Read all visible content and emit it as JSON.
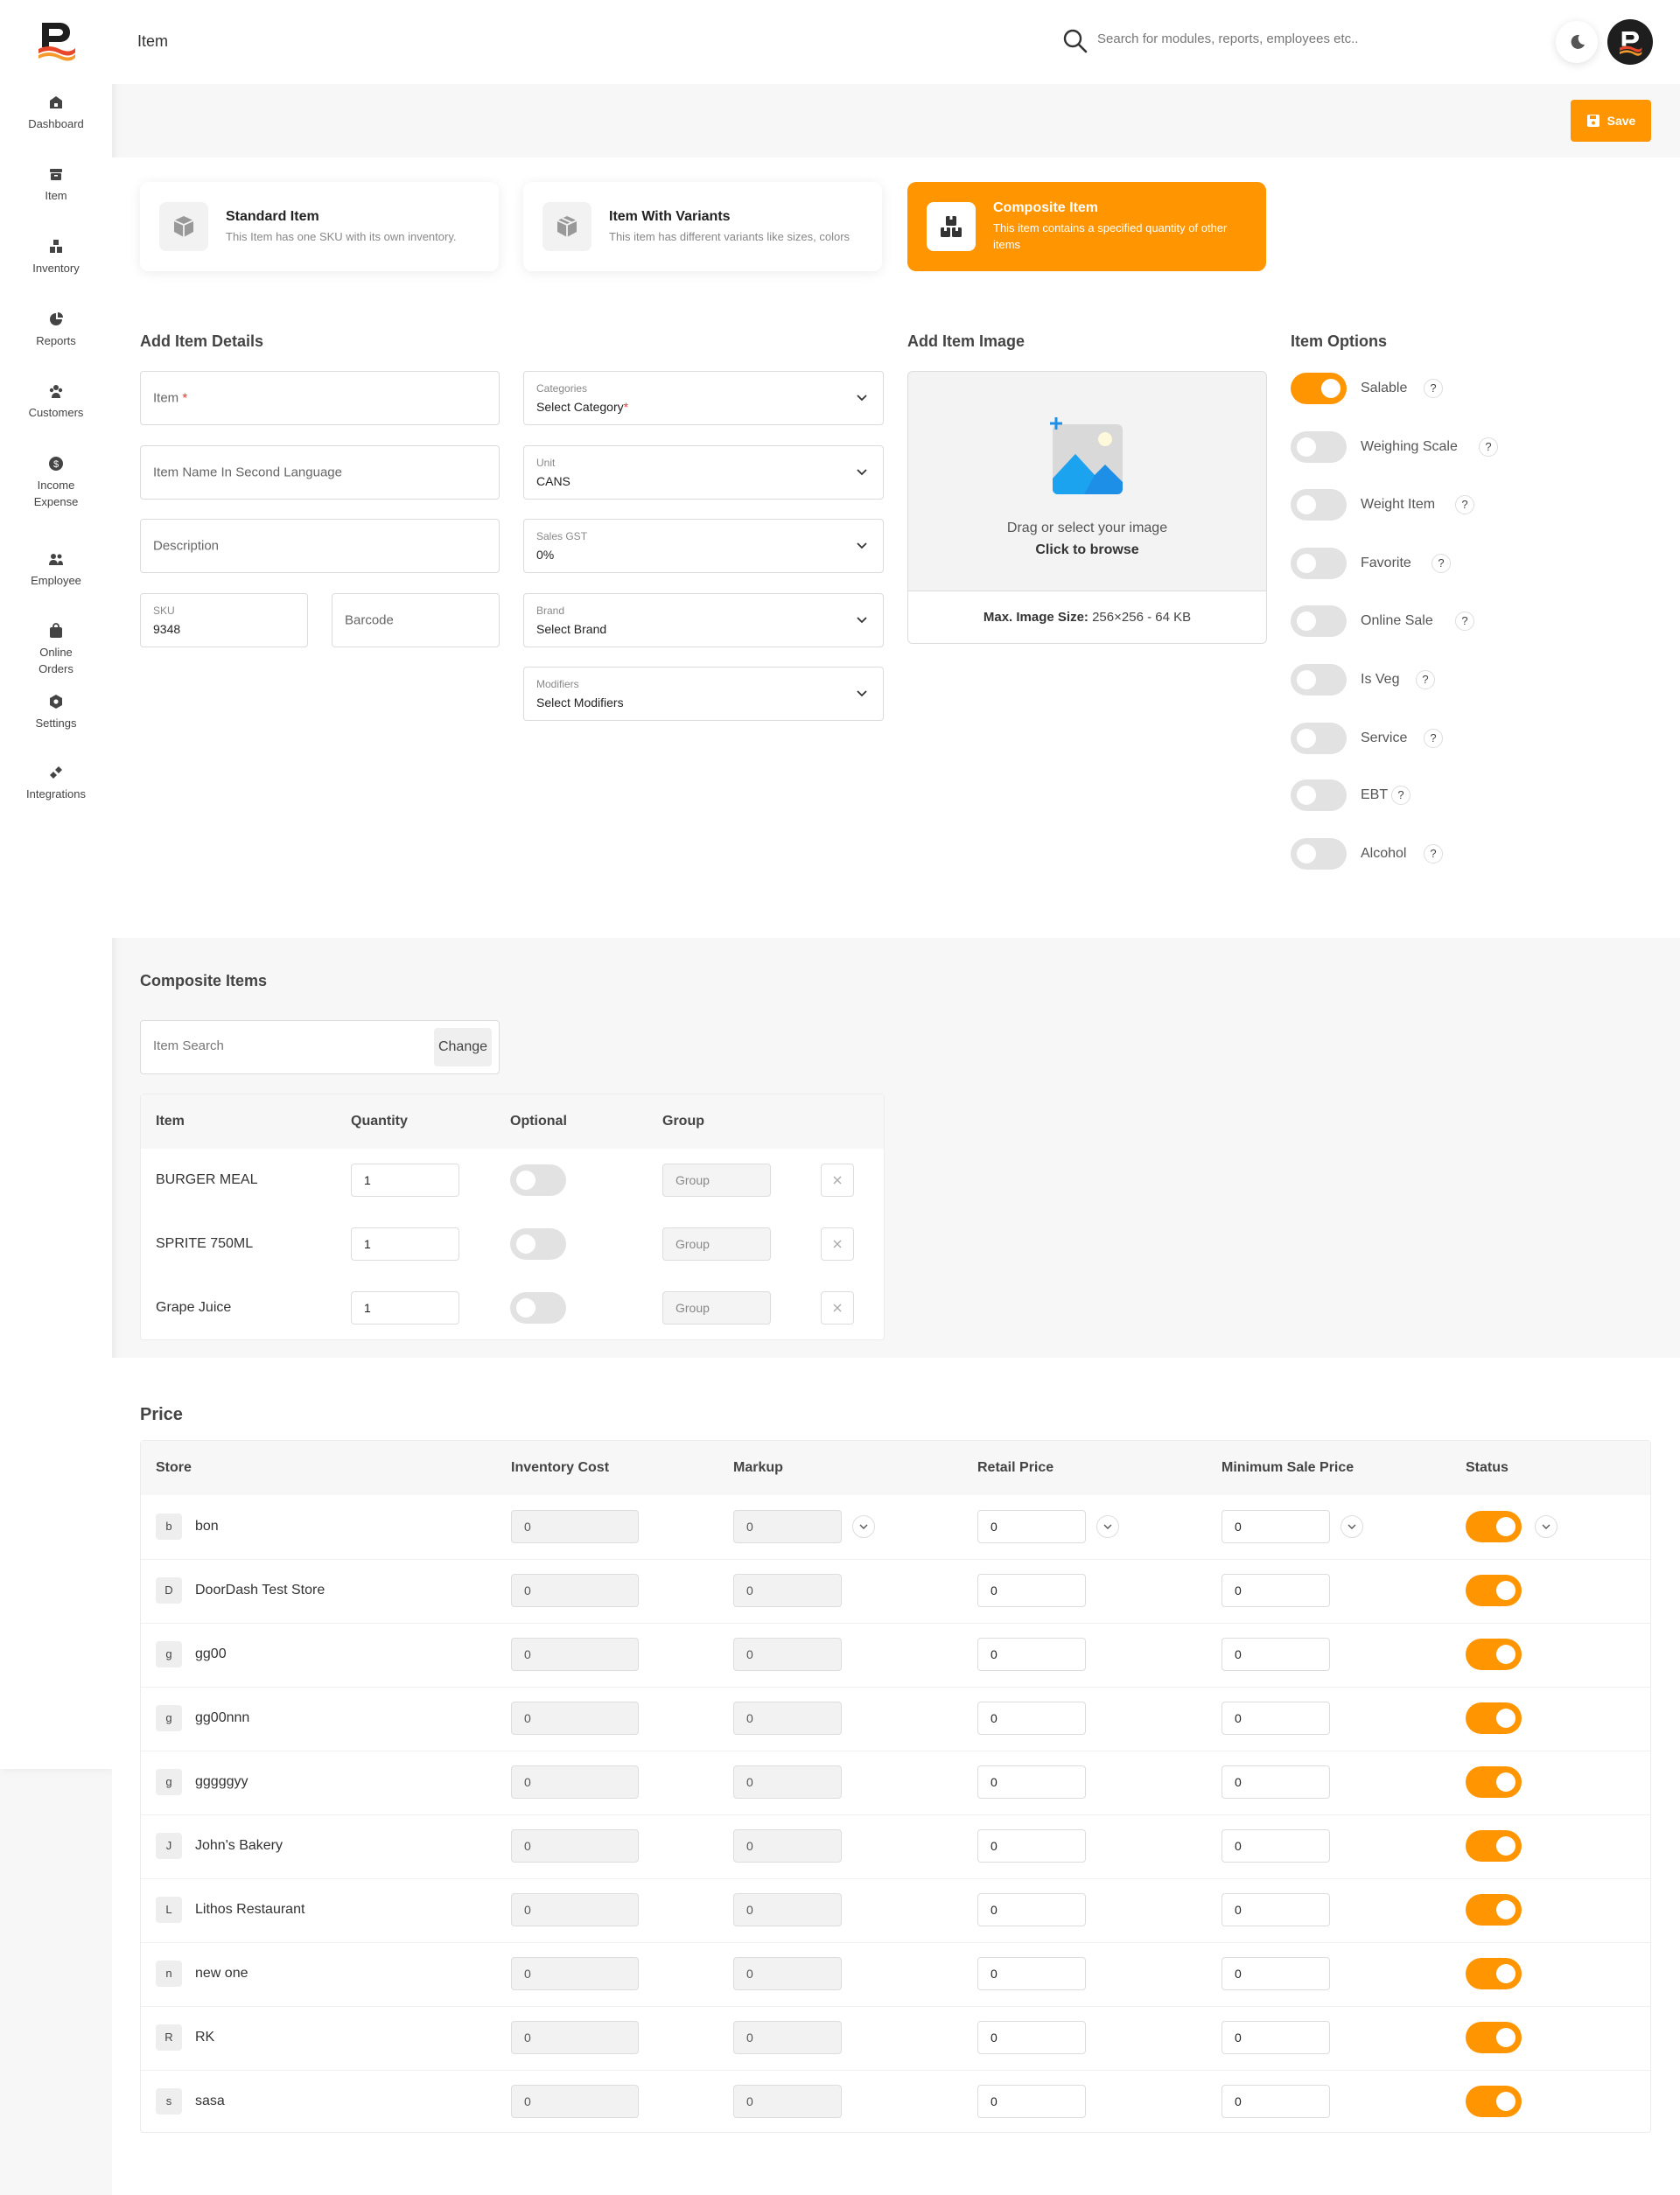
{
  "header": {
    "title": "Item",
    "search_placeholder": "Search for modules, reports, employees etc.."
  },
  "sidebar": {
    "items": [
      {
        "label": "Dashboard",
        "icon": "home-icon"
      },
      {
        "label": "Item",
        "icon": "archive-icon"
      },
      {
        "label": "Inventory",
        "icon": "boxes-icon"
      },
      {
        "label": "Reports",
        "icon": "pie-chart-icon"
      },
      {
        "label": "Customers",
        "icon": "users-icon"
      },
      {
        "label": "Income Expense",
        "icon": "dollar-icon"
      },
      {
        "label": "Employee",
        "icon": "employee-icon"
      },
      {
        "label": "Online Orders",
        "icon": "shopping-bag-icon"
      },
      {
        "label": "Settings",
        "icon": "gear-icon"
      },
      {
        "label": "Integrations",
        "icon": "plug-icon"
      }
    ]
  },
  "toolbar": {
    "save_label": "Save"
  },
  "item_types": [
    {
      "title": "Standard Item",
      "desc": "This Item has one SKU with its own inventory.",
      "active": false
    },
    {
      "title": "Item With Variants",
      "desc": "This item has different variants like sizes, colors",
      "active": false
    },
    {
      "title": "Composite Item",
      "desc": "This item contains a specified quantity of other items",
      "active": true
    }
  ],
  "details": {
    "title": "Add Item Details",
    "item_placeholder": "Item",
    "item_required": "*",
    "second_language_placeholder": "Item Name In Second Language",
    "description_placeholder": "Description",
    "sku_label": "SKU",
    "sku_value": "9348",
    "barcode_placeholder": "Barcode",
    "categories_label": "Categories",
    "categories_value": "Select Category",
    "categories_required": "*",
    "unit_label": "Unit",
    "unit_value": "CANS",
    "gst_label": "Sales GST",
    "gst_value": "0%",
    "brand_label": "Brand",
    "brand_value": "Select Brand",
    "modifiers_label": "Modifiers",
    "modifiers_value": "Select Modifiers"
  },
  "image": {
    "title": "Add Item Image",
    "drag_text": "Drag or select your image",
    "browse_text": "Click to browse",
    "max_label": "Max. Image Size:",
    "max_value": "256×256 - 64 KB"
  },
  "options": {
    "title": "Item Options",
    "items": [
      {
        "label": "Salable",
        "on": true
      },
      {
        "label": "Weighing Scale",
        "on": false
      },
      {
        "label": "Weight Item",
        "on": false
      },
      {
        "label": "Favorite",
        "on": false
      },
      {
        "label": "Online Sale",
        "on": false
      },
      {
        "label": "Is Veg",
        "on": false
      },
      {
        "label": "Service",
        "on": false
      },
      {
        "label": "EBT",
        "on": false
      },
      {
        "label": "Alcohol",
        "on": false
      }
    ],
    "help": "?"
  },
  "composite": {
    "title": "Composite Items",
    "search_placeholder": "Item Search",
    "change_label": "Change",
    "headers": [
      "Item",
      "Quantity",
      "Optional",
      "Group"
    ],
    "rows": [
      {
        "item": "BURGER MEAL",
        "quantity": "1",
        "optional": false,
        "group": "Group"
      },
      {
        "item": "SPRITE 750ML",
        "quantity": "1",
        "optional": false,
        "group": "Group"
      },
      {
        "item": "Grape Juice",
        "quantity": "1",
        "optional": false,
        "group": "Group"
      }
    ]
  },
  "price": {
    "title": "Price",
    "headers": [
      "Store",
      "Inventory Cost",
      "Markup",
      "Retail Price",
      "Minimum Sale Price",
      "Status"
    ],
    "rows": [
      {
        "badge": "b",
        "store": "bon",
        "cost": "0",
        "markup": "0",
        "retail": "0",
        "min": "0",
        "status": true
      },
      {
        "badge": "D",
        "store": "DoorDash Test Store",
        "cost": "0",
        "markup": "0",
        "retail": "0",
        "min": "0",
        "status": true
      },
      {
        "badge": "g",
        "store": "gg00",
        "cost": "0",
        "markup": "0",
        "retail": "0",
        "min": "0",
        "status": true
      },
      {
        "badge": "g",
        "store": "gg00nnn",
        "cost": "0",
        "markup": "0",
        "retail": "0",
        "min": "0",
        "status": true
      },
      {
        "badge": "g",
        "store": "gggggyy",
        "cost": "0",
        "markup": "0",
        "retail": "0",
        "min": "0",
        "status": true
      },
      {
        "badge": "J",
        "store": "John's Bakery",
        "cost": "0",
        "markup": "0",
        "retail": "0",
        "min": "0",
        "status": true
      },
      {
        "badge": "L",
        "store": "Lithos Restaurant",
        "cost": "0",
        "markup": "0",
        "retail": "0",
        "min": "0",
        "status": true
      },
      {
        "badge": "n",
        "store": "new one",
        "cost": "0",
        "markup": "0",
        "retail": "0",
        "min": "0",
        "status": true
      },
      {
        "badge": "R",
        "store": "RK",
        "cost": "0",
        "markup": "0",
        "retail": "0",
        "min": "0",
        "status": true
      },
      {
        "badge": "s",
        "store": "sasa",
        "cost": "0",
        "markup": "0",
        "retail": "0",
        "min": "0",
        "status": true
      }
    ]
  },
  "colors": {
    "accent": "#ff9500",
    "logo_red": "#e8472a",
    "toggle_off": "#e2e2e2"
  }
}
